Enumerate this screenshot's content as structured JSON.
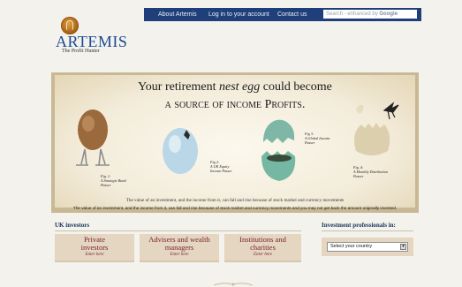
{
  "topnav": {
    "about": "About Artemis",
    "login": "Log in to your account",
    "contact": "Contact us",
    "search_placeholder": "Search - enhanced by",
    "search_brand": "Google"
  },
  "logo": {
    "name": "ARTEMIS",
    "tagline": "The Profit Hunter"
  },
  "banner": {
    "headline_part1": "Your retirement ",
    "headline_em": "nest egg",
    "headline_part2": " could become",
    "headline_line2": "a source of income Profits.",
    "fig1": "Fig. 1:\nA Strategic Bond\nPasser",
    "fig2": "Fig 2:\nA UK Equity\nIncome Passer",
    "fig3": "Fig 3:\nA Global Income\nPasser",
    "fig4": "Fig. 4:\nA Monthly Distribution\nPasser",
    "disclaimer": "The value of an investment, and the income from it, can fall and rise because of stock market and currency movements",
    "disclaimer_line2": "and you may not get back the amount originally invested.",
    "disclaimer_overlay": "The value of an investment, and the income from it, can fall and rise because of stock market and currency movements and you may not get back the amount originally invested."
  },
  "uk_investors": {
    "label": "UK investors",
    "cards": [
      {
        "title": "Private investors",
        "enter": "Enter here"
      },
      {
        "title": "Advisers and wealth managers",
        "enter": "Enter here"
      },
      {
        "title": "Institutions and charities",
        "enter": "Enter here"
      }
    ]
  },
  "professionals": {
    "label": "Investment professionals in:",
    "select_value": "Select your country"
  },
  "colors": {
    "nav": "#1f3f7a",
    "brand_blue": "#1c4a93",
    "card_text": "#7a2330",
    "card_bg": "#e4d6c0"
  }
}
